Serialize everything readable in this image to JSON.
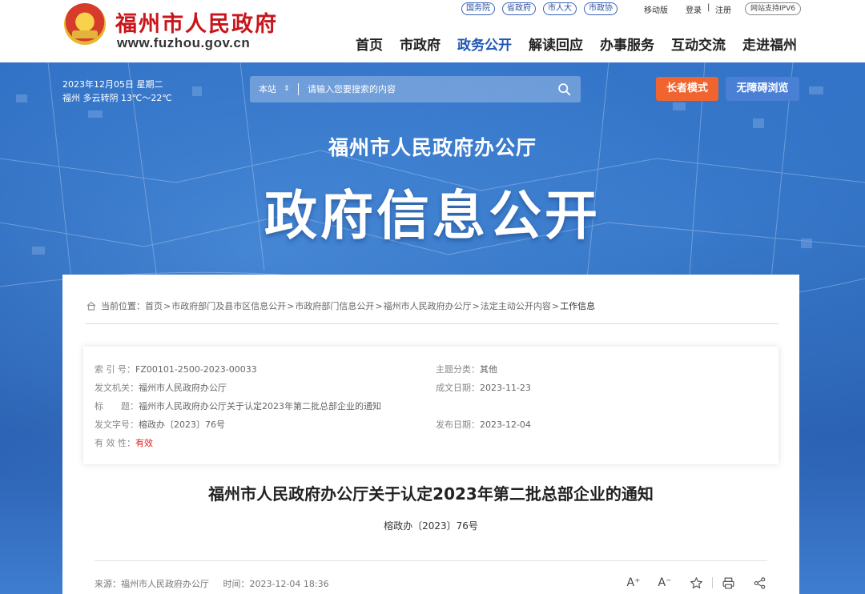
{
  "header": {
    "site_name": "福州市人民政府",
    "site_url": "www.fuzhou.gov.cn",
    "quicklinks": [
      "国务院",
      "省政府",
      "市人大",
      "市政协"
    ],
    "mobile_label": "移动版",
    "login_label": "登录",
    "separator": "|",
    "register_label": "注册",
    "ipv6_label": "网站支持IPV6",
    "nav": [
      "首页",
      "市政府",
      "政务公开",
      "解读回应",
      "办事服务",
      "互动交流",
      "走进福州"
    ],
    "nav_active": "政务公开"
  },
  "banner": {
    "date": "2023年12月05日 星期二",
    "weather": "福州 多云转阴 13℃～22℃",
    "search_scope": "本站",
    "search_scope_arrow": "⇕",
    "search_placeholder": "请输入您要搜索的内容",
    "elder_mode": "长者模式",
    "accessible_mode": "无障碍浏览",
    "department_title": "福州市人民政府办公厅",
    "main_title": "政府信息公开"
  },
  "breadcrumb": {
    "prefix": "当前位置：",
    "items": [
      "首页",
      "市政府部门及县市区信息公开",
      "市政府部门信息公开",
      "福州市人民政府办公厅",
      "法定主动公开内容"
    ],
    "separator": ">",
    "current": "工作信息"
  },
  "meta": {
    "index_key": "索 引 号：",
    "index_val": "FZ00101-2500-2023-00033",
    "topic_key": "主题分类：",
    "topic_val": "其他",
    "issuer_key": "发文机关：",
    "issuer_val": "福州市人民政府办公厅",
    "created_key": "成文日期：",
    "created_val": "2023-11-23",
    "title_key": "标　　题：",
    "title_val": "福州市人民政府办公厅关于认定2023年第二批总部企业的通知",
    "docno_key": "发文字号：",
    "docno_val": "榕政办〔2023〕76号",
    "published_key": "发布日期：",
    "published_val": "2023-12-04",
    "validity_key": "有 效 性：",
    "validity_val": "有效"
  },
  "document": {
    "title": "福州市人民政府办公厅关于认定2023年第二批总部企业的通知",
    "number": "榕政办〔2023〕76号",
    "source_label": "来源：福州市人民政府办公厅",
    "time_label": "时间：2023-12-04 18:36",
    "font_increase": "A⁺",
    "font_decrease": "A⁻"
  },
  "colors": {
    "brand_red": "#c8161d",
    "nav_active": "#1f56b5",
    "elder_button": "#f06430",
    "access_button": "#4a7fd6",
    "validity_red": "#e02020"
  }
}
